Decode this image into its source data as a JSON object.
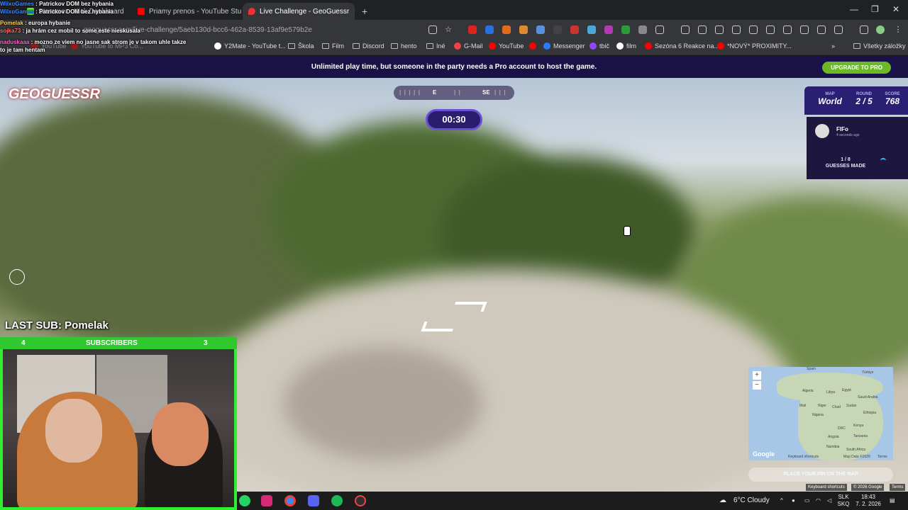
{
  "browser": {
    "tabs": [
      {
        "label": "Streamer - Kick Dashboard",
        "active": false
      },
      {
        "label": "Priamy prenos - YouTube Studio",
        "active": false
      },
      {
        "label": "Live Challenge - GeoGuessr",
        "active": true
      }
    ],
    "new_tab": "+",
    "url": "geoguessr.com/live-challenge/5aeb130d-bcc6-462a-8539-13af9e579b2e",
    "bookmarks": [
      "YouTube",
      "YouTube to MP3 Co...",
      "Y2Mate - YouTube t...",
      "Škola",
      "Film",
      "Discord",
      "hento",
      "Iné",
      "G-Mail",
      "YouTube",
      "Messenger",
      "tbič",
      "film",
      "Sezóna 6 Reakce na...",
      "*NOVÝ* PROXIMITY..."
    ],
    "bookmarks_more": "»",
    "all_bookmarks": "Všetky záložky"
  },
  "chat": [
    {
      "user": "WilxoGames",
      "text": "Patrickov DOM bez hybania"
    },
    {
      "user": "WilxoGames",
      "text": "Patrickov DOM bez hybania"
    },
    {
      "user": "Pomelak",
      "text": "europa hybanie"
    },
    {
      "user": "sojka73",
      "text": "ja hrám cez mobil to some este nieskusala"
    },
    {
      "user": "naduskaaa",
      "text": "mozno ze viem no jasne sak strom je v takom uhle takze to je tam hentam"
    }
  ],
  "banner": {
    "text": "Unlimited play time, but someone in the party needs a Pro account to host the game.",
    "upgrade": "UPGRADE TO PRO"
  },
  "game": {
    "logo": "GEOGUESSR",
    "compass": {
      "e": "E",
      "se": "SE"
    },
    "timer": "00:30",
    "map_label": "MAP",
    "map_value": "World",
    "round_label": "ROUND",
    "round_value": "2 / 5",
    "score_label": "SCORE",
    "score_value": "768",
    "player_name": "FIFo",
    "player_time": "4 seconds ago",
    "guesses_count": "1 / 8",
    "guesses_label": "GUESSES MADE",
    "place_pin": "PLACE YOUR PIN ON THE MAP",
    "map_labels": [
      "Spain",
      "Türkiye",
      "Algeria",
      "Libya",
      "Egypt",
      "Saudi Arabia",
      "Mali",
      "Niger",
      "Chad",
      "Sudan",
      "Nigeria",
      "Ethiopia",
      "DRC",
      "Kenya",
      "Tanzania",
      "Angola",
      "Namibia",
      "South Africa"
    ],
    "map_footer": [
      "Google",
      "Keyboard shortcuts",
      "Map Data ©2026",
      "Terms"
    ],
    "credit": [
      "Keyboard shortcuts",
      "© 2026 Google",
      "Terms"
    ]
  },
  "stream": {
    "last_sub": "LAST SUB: Pomelak",
    "subs_left": "4",
    "subs_label": "SUBSCRIBERS",
    "subs_right": "3"
  },
  "taskbar": {
    "weather": "6°C  Cloudy",
    "lang_top": "SLK",
    "lang_bottom": "SKQ",
    "time": "18:43",
    "date": "7. 2. 2026"
  }
}
